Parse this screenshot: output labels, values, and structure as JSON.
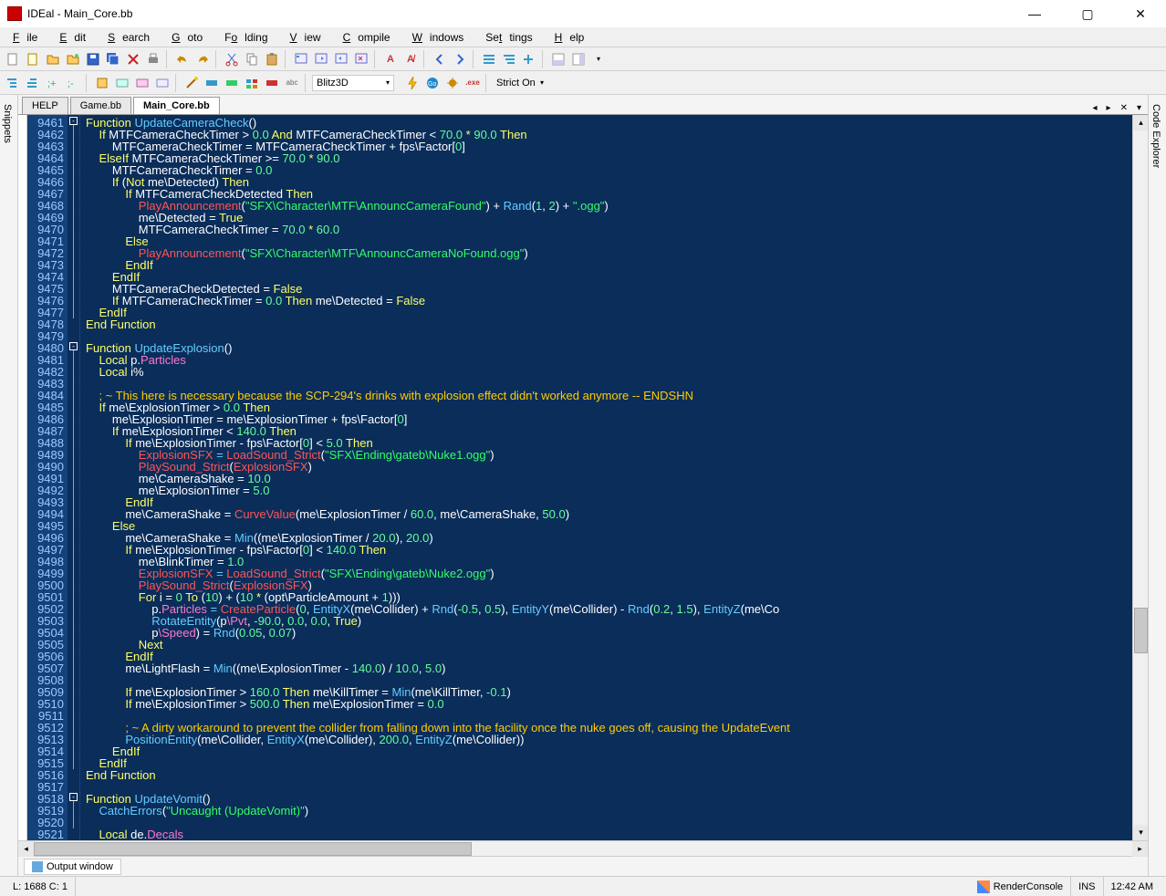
{
  "window": {
    "title": "IDEal - Main_Core.bb",
    "min": "—",
    "max": "▢",
    "close": "✕"
  },
  "menu": {
    "file": "File",
    "edit": "Edit",
    "search": "Search",
    "goto": "Goto",
    "folding": "Folding",
    "view": "View",
    "compile": "Compile",
    "windows": "Windows",
    "settings": "Settings",
    "help": "Help"
  },
  "toolbar2": {
    "compiler": "Blitz3D",
    "strict": "Strict On"
  },
  "side": {
    "left": "Snippets",
    "right": "Code Explorer"
  },
  "tabs": {
    "help": "HELP",
    "game": "Game.bb",
    "main": "Main_Core.bb"
  },
  "output_tab": "Output window",
  "status": {
    "pos": "L: 1688 C: 1",
    "proc": "RenderConsole",
    "mode": "INS",
    "time": "12:42 AM"
  },
  "gutter": {
    "start": 9461,
    "end": 9521
  },
  "fold_markers": [
    0,
    19,
    57
  ],
  "code_lines": [
    [
      [
        "kw",
        "Function "
      ],
      [
        "fn",
        "UpdateCameraCheck"
      ],
      [
        "",
        "()"
      ]
    ],
    [
      [
        "",
        "    "
      ],
      [
        "kw",
        "If "
      ],
      [
        "",
        "MTFCameraCheckTimer > "
      ],
      [
        "num",
        "0.0"
      ],
      [
        "kw",
        " And "
      ],
      [
        "",
        "MTFCameraCheckTimer < "
      ],
      [
        "num",
        "70.0"
      ],
      [
        "kw",
        " * "
      ],
      [
        "num",
        "90.0"
      ],
      [
        "kw",
        " Then"
      ]
    ],
    [
      [
        "",
        "        MTFCameraCheckTimer = MTFCameraCheckTimer + fps\\Factor["
      ],
      [
        "num",
        "0"
      ],
      [
        "",
        "]"
      ]
    ],
    [
      [
        "",
        "    "
      ],
      [
        "kw",
        "ElseIf "
      ],
      [
        "",
        "MTFCameraCheckTimer >= "
      ],
      [
        "num",
        "70.0"
      ],
      [
        "kw",
        " * "
      ],
      [
        "num",
        "90.0"
      ]
    ],
    [
      [
        "",
        "        MTFCameraCheckTimer = "
      ],
      [
        "num",
        "0.0"
      ]
    ],
    [
      [
        "",
        "        "
      ],
      [
        "kw",
        "If "
      ],
      [
        "",
        "("
      ],
      [
        "kw",
        "Not "
      ],
      [
        "",
        "me\\Detected) "
      ],
      [
        "kw",
        "Then"
      ]
    ],
    [
      [
        "",
        "            "
      ],
      [
        "kw",
        "If "
      ],
      [
        "",
        "MTFCameraCheckDetected "
      ],
      [
        "kw",
        "Then"
      ]
    ],
    [
      [
        "",
        "                "
      ],
      [
        "call",
        "PlayAnnouncement"
      ],
      [
        "",
        "("
      ],
      [
        "str",
        "\"SFX\\Character\\MTF\\AnnouncCameraFound\""
      ],
      [
        "",
        ") + "
      ],
      [
        "fn",
        "Rand"
      ],
      [
        "",
        "("
      ],
      [
        "num",
        "1"
      ],
      [
        "",
        ", "
      ],
      [
        "num",
        "2"
      ],
      [
        "",
        ") + "
      ],
      [
        "str",
        "\".ogg\""
      ],
      [
        "",
        ")"
      ]
    ],
    [
      [
        "",
        "                me\\Detected = "
      ],
      [
        "kw",
        "True"
      ]
    ],
    [
      [
        "",
        "                MTFCameraCheckTimer = "
      ],
      [
        "num",
        "70.0"
      ],
      [
        "kw",
        " * "
      ],
      [
        "num",
        "60.0"
      ]
    ],
    [
      [
        "",
        "            "
      ],
      [
        "kw",
        "Else"
      ]
    ],
    [
      [
        "",
        "                "
      ],
      [
        "call",
        "PlayAnnouncement"
      ],
      [
        "",
        "("
      ],
      [
        "str",
        "\"SFX\\Character\\MTF\\AnnouncCameraNoFound.ogg\""
      ],
      [
        "",
        ")"
      ]
    ],
    [
      [
        "",
        "            "
      ],
      [
        "kw",
        "EndIf"
      ]
    ],
    [
      [
        "",
        "        "
      ],
      [
        "kw",
        "EndIf"
      ]
    ],
    [
      [
        "",
        "        MTFCameraCheckDetected = "
      ],
      [
        "kw",
        "False"
      ]
    ],
    [
      [
        "",
        "        "
      ],
      [
        "kw",
        "If "
      ],
      [
        "",
        "MTFCameraCheckTimer = "
      ],
      [
        "num",
        "0.0"
      ],
      [
        "kw",
        " Then "
      ],
      [
        "",
        "me\\Detected = "
      ],
      [
        "kw",
        "False"
      ]
    ],
    [
      [
        "",
        "    "
      ],
      [
        "kw",
        "EndIf"
      ]
    ],
    [
      [
        "kw",
        "End Function"
      ]
    ],
    [
      [
        "",
        ""
      ]
    ],
    [
      [
        "kw",
        "Function "
      ],
      [
        "fn",
        "UpdateExplosion"
      ],
      [
        "",
        "()"
      ]
    ],
    [
      [
        "",
        "    "
      ],
      [
        "kw",
        "Local "
      ],
      [
        "",
        "p."
      ],
      [
        "type",
        "Particles"
      ]
    ],
    [
      [
        "",
        "    "
      ],
      [
        "kw",
        "Local "
      ],
      [
        "",
        "i%"
      ]
    ],
    [
      [
        "",
        ""
      ]
    ],
    [
      [
        "",
        "    "
      ],
      [
        "cm",
        "; ~ This here is necessary because the SCP-294's drinks with explosion effect didn't worked anymore -- ENDSHN"
      ]
    ],
    [
      [
        "",
        "    "
      ],
      [
        "kw",
        "If "
      ],
      [
        "",
        "me\\ExplosionTimer > "
      ],
      [
        "num",
        "0.0"
      ],
      [
        "kw",
        " Then"
      ]
    ],
    [
      [
        "",
        "        me\\ExplosionTimer = me\\ExplosionTimer + fps\\Factor["
      ],
      [
        "num",
        "0"
      ],
      [
        "",
        "]"
      ]
    ],
    [
      [
        "",
        "        "
      ],
      [
        "kw",
        "If "
      ],
      [
        "",
        "me\\ExplosionTimer < "
      ],
      [
        "num",
        "140.0"
      ],
      [
        "kw",
        " Then"
      ]
    ],
    [
      [
        "",
        "            "
      ],
      [
        "kw",
        "If "
      ],
      [
        "",
        "me\\ExplosionTimer - fps\\Factor["
      ],
      [
        "num",
        "0"
      ],
      [
        "",
        "] < "
      ],
      [
        "num",
        "5.0"
      ],
      [
        "kw",
        " Then"
      ]
    ],
    [
      [
        "",
        "                "
      ],
      [
        "call",
        "ExplosionSFX"
      ],
      [
        "fn",
        " = "
      ],
      [
        "call",
        "LoadSound_Strict"
      ],
      [
        "",
        "("
      ],
      [
        "str",
        "\"SFX\\Ending\\gateb\\Nuke1.ogg\""
      ],
      [
        "",
        ")"
      ]
    ],
    [
      [
        "",
        "                "
      ],
      [
        "call",
        "PlaySound_Strict"
      ],
      [
        "",
        "("
      ],
      [
        "call",
        "ExplosionSFX"
      ],
      [
        "",
        ")"
      ]
    ],
    [
      [
        "",
        "                me\\CameraShake = "
      ],
      [
        "num",
        "10.0"
      ]
    ],
    [
      [
        "",
        "                me\\ExplosionTimer = "
      ],
      [
        "num",
        "5.0"
      ]
    ],
    [
      [
        "",
        "            "
      ],
      [
        "kw",
        "EndIf"
      ]
    ],
    [
      [
        "",
        "            me\\CameraShake = "
      ],
      [
        "call",
        "CurveValue"
      ],
      [
        "",
        "(me\\ExplosionTimer / "
      ],
      [
        "num",
        "60.0"
      ],
      [
        "",
        ", me\\CameraShake, "
      ],
      [
        "num",
        "50.0"
      ],
      [
        "",
        ")"
      ]
    ],
    [
      [
        "",
        "        "
      ],
      [
        "kw",
        "Else"
      ]
    ],
    [
      [
        "",
        "            me\\CameraShake = "
      ],
      [
        "fn",
        "Min"
      ],
      [
        "",
        "((me\\ExplosionTimer / "
      ],
      [
        "num",
        "20.0"
      ],
      [
        "",
        "), "
      ],
      [
        "num",
        "20.0"
      ],
      [
        "",
        ")"
      ]
    ],
    [
      [
        "",
        "            "
      ],
      [
        "kw",
        "If "
      ],
      [
        "",
        "me\\ExplosionTimer - fps\\Factor["
      ],
      [
        "num",
        "0"
      ],
      [
        "",
        "] < "
      ],
      [
        "num",
        "140.0"
      ],
      [
        "kw",
        " Then"
      ]
    ],
    [
      [
        "",
        "                me\\BlinkTimer = "
      ],
      [
        "num",
        "1.0"
      ]
    ],
    [
      [
        "",
        "                "
      ],
      [
        "call",
        "ExplosionSFX"
      ],
      [
        "fn",
        " = "
      ],
      [
        "call",
        "LoadSound_Strict"
      ],
      [
        "",
        "("
      ],
      [
        "str",
        "\"SFX\\Ending\\gateb\\Nuke2.ogg\""
      ],
      [
        "",
        ")"
      ]
    ],
    [
      [
        "",
        "                "
      ],
      [
        "call",
        "PlaySound_Strict"
      ],
      [
        "",
        "("
      ],
      [
        "call",
        "ExplosionSFX"
      ],
      [
        "",
        ")"
      ]
    ],
    [
      [
        "",
        "                "
      ],
      [
        "kw",
        "For "
      ],
      [
        "",
        "i = "
      ],
      [
        "num",
        "0"
      ],
      [
        "kw",
        " To "
      ],
      [
        "",
        "("
      ],
      [
        "num",
        "10"
      ],
      [
        "",
        ") + ("
      ],
      [
        "num",
        "10"
      ],
      [
        "kw",
        " * "
      ],
      [
        "",
        "(opt\\ParticleAmount + "
      ],
      [
        "num",
        "1"
      ],
      [
        "",
        ")))"
      ]
    ],
    [
      [
        "",
        "                    p."
      ],
      [
        "type",
        "Particles"
      ],
      [
        "fn",
        " = "
      ],
      [
        "call",
        "CreateParticle"
      ],
      [
        "",
        "("
      ],
      [
        "num",
        "0"
      ],
      [
        "",
        ", "
      ],
      [
        "fn",
        "EntityX"
      ],
      [
        "",
        "(me\\Collider) + "
      ],
      [
        "fn",
        "Rnd"
      ],
      [
        "",
        "("
      ],
      [
        "num",
        "-0.5"
      ],
      [
        "",
        ", "
      ],
      [
        "num",
        "0.5"
      ],
      [
        "",
        "), "
      ],
      [
        "fn",
        "EntityY"
      ],
      [
        "",
        "(me\\Collider) - "
      ],
      [
        "fn",
        "Rnd"
      ],
      [
        "",
        "("
      ],
      [
        "num",
        "0.2"
      ],
      [
        "",
        ", "
      ],
      [
        "num",
        "1.5"
      ],
      [
        "",
        "), "
      ],
      [
        "fn",
        "EntityZ"
      ],
      [
        "",
        "(me\\Co"
      ]
    ],
    [
      [
        "",
        "                    "
      ],
      [
        "fn",
        "RotateEntity"
      ],
      [
        "",
        "(p"
      ],
      [
        "type",
        "\\Pvt"
      ],
      [
        "",
        ", "
      ],
      [
        "num",
        "-90.0"
      ],
      [
        "",
        ", "
      ],
      [
        "num",
        "0.0"
      ],
      [
        "",
        ", "
      ],
      [
        "num",
        "0.0"
      ],
      [
        "",
        ", "
      ],
      [
        "kw",
        "True"
      ],
      [
        "",
        ")"
      ]
    ],
    [
      [
        "",
        "                    p"
      ],
      [
        "type",
        "\\Speed"
      ],
      [
        "",
        ") = "
      ],
      [
        "fn",
        "Rnd"
      ],
      [
        "",
        "("
      ],
      [
        "num",
        "0.05"
      ],
      [
        "",
        ", "
      ],
      [
        "num",
        "0.07"
      ],
      [
        "",
        ")"
      ]
    ],
    [
      [
        "",
        "                "
      ],
      [
        "kw",
        "Next"
      ]
    ],
    [
      [
        "",
        "            "
      ],
      [
        "kw",
        "EndIf"
      ]
    ],
    [
      [
        "",
        "            me\\LightFlash = "
      ],
      [
        "fn",
        "Min"
      ],
      [
        "",
        "((me\\ExplosionTimer - "
      ],
      [
        "num",
        "140.0"
      ],
      [
        "",
        ") / "
      ],
      [
        "num",
        "10.0"
      ],
      [
        "",
        ", "
      ],
      [
        "num",
        "5.0"
      ],
      [
        "",
        ")"
      ]
    ],
    [
      [
        "",
        ""
      ]
    ],
    [
      [
        "",
        "            "
      ],
      [
        "kw",
        "If "
      ],
      [
        "",
        "me\\ExplosionTimer > "
      ],
      [
        "num",
        "160.0"
      ],
      [
        "kw",
        " Then "
      ],
      [
        "",
        "me\\KillTimer = "
      ],
      [
        "fn",
        "Min"
      ],
      [
        "",
        "(me\\KillTimer, "
      ],
      [
        "num",
        "-0.1"
      ],
      [
        "",
        ")"
      ]
    ],
    [
      [
        "",
        "            "
      ],
      [
        "kw",
        "If "
      ],
      [
        "",
        "me\\ExplosionTimer > "
      ],
      [
        "num",
        "500.0"
      ],
      [
        "kw",
        " Then "
      ],
      [
        "",
        "me\\ExplosionTimer = "
      ],
      [
        "num",
        "0.0"
      ]
    ],
    [
      [
        "",
        ""
      ]
    ],
    [
      [
        "",
        "            "
      ],
      [
        "cm",
        "; ~ A dirty workaround to prevent the collider from falling down into the facility once the nuke goes off, causing the UpdateEvent"
      ]
    ],
    [
      [
        "",
        "            "
      ],
      [
        "fn",
        "PositionEntity"
      ],
      [
        "",
        "(me\\Collider, "
      ],
      [
        "fn",
        "EntityX"
      ],
      [
        "",
        "(me\\Collider), "
      ],
      [
        "num",
        "200.0"
      ],
      [
        "",
        ", "
      ],
      [
        "fn",
        "EntityZ"
      ],
      [
        "",
        "(me\\Collider))"
      ]
    ],
    [
      [
        "",
        "        "
      ],
      [
        "kw",
        "EndIf"
      ]
    ],
    [
      [
        "",
        "    "
      ],
      [
        "kw",
        "EndIf"
      ]
    ],
    [
      [
        "kw",
        "End Function"
      ]
    ],
    [
      [
        "",
        ""
      ]
    ],
    [
      [
        "kw",
        "Function "
      ],
      [
        "fn",
        "UpdateVomit"
      ],
      [
        "",
        "()"
      ]
    ],
    [
      [
        "",
        "    "
      ],
      [
        "fn",
        "CatchErrors"
      ],
      [
        "",
        "("
      ],
      [
        "str",
        "\"Uncaught (UpdateVomit)\""
      ],
      [
        "",
        ")"
      ]
    ],
    [
      [
        "",
        ""
      ]
    ],
    [
      [
        "",
        "    "
      ],
      [
        "kw",
        "Local "
      ],
      [
        "",
        "de."
      ],
      [
        "type",
        "Decals"
      ]
    ]
  ]
}
